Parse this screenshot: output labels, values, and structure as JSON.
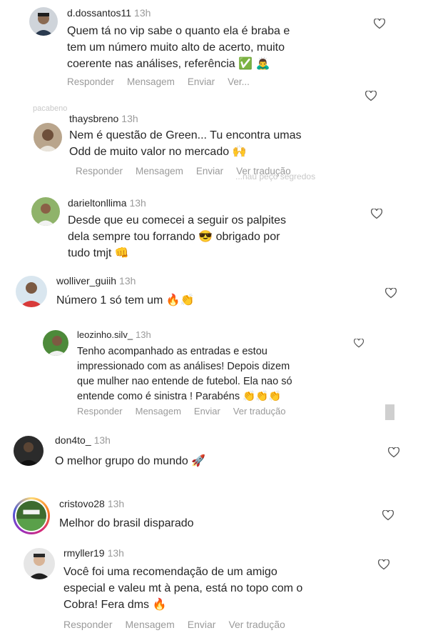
{
  "comments": [
    {
      "username": "d.dossantos11",
      "time": "13h",
      "lines": [
        "Quem tá no vip sabe o quanto ela é braba e",
        "tem um número muito alto de acerto, muito",
        "coerente nas análises, referência ✅ 🙇‍♂️"
      ],
      "actions": [
        "Responder",
        "Mensagem",
        "Enviar",
        "Ver..."
      ]
    },
    {
      "username": "thaysbreno",
      "time": "13h",
      "lines": [
        "Nem é questão de Green... Tu encontra umas",
        "Odd de muito valor no mercado 🙌"
      ],
      "actions": [
        "Responder",
        "Mensagem",
        "Enviar",
        "Ver tradução"
      ]
    },
    {
      "username": "darieltonllima",
      "time": "13h",
      "lines": [
        "Desde que eu comecei a seguir os palpites",
        "dela sempre tou forrando 😎 obrigado por",
        "tudo tmjt 👊"
      ],
      "actions": []
    },
    {
      "username": "wolliver_guiih",
      "time": "13h",
      "lines": [
        "Número 1 só tem um 🔥👏"
      ],
      "actions": []
    },
    {
      "username": "leozinho.silv_",
      "time": "13h",
      "lines": [
        "Tenho acompanhado as entradas e estou",
        "impressionado com as análises! Depois dizem",
        "que mulher nao entende de futebol. Ela nao só",
        "entende como  é  sinistra ! Parabéns 👏👏👏"
      ],
      "actions": [
        "Responder",
        "Mensagem",
        "Enviar",
        "Ver tradução"
      ]
    },
    {
      "username": "don4to_",
      "time": "13h",
      "lines": [
        "O melhor grupo do mundo 🚀"
      ],
      "actions": []
    },
    {
      "username": "cristovo28",
      "time": "13h",
      "lines": [
        "Melhor do brasil disparado"
      ],
      "actions": []
    },
    {
      "username": "rmyller19",
      "time": "13h",
      "lines": [
        "Você foi uma recomendação de um amigo",
        "especial e valeu mt à pena, está no topo com o",
        "Cobra! Fera dms 🔥"
      ],
      "actions": [
        "Responder",
        "Mensagem",
        "Enviar",
        "Ver tradução"
      ]
    }
  ],
  "ghosts": {
    "g1": "pacabeno",
    "g2": "...nau peço segredos"
  },
  "colors": {
    "username": "#262626",
    "meta": "#9a9a9a",
    "heart_outline": "#555555",
    "story_ring": "#d6249f"
  }
}
